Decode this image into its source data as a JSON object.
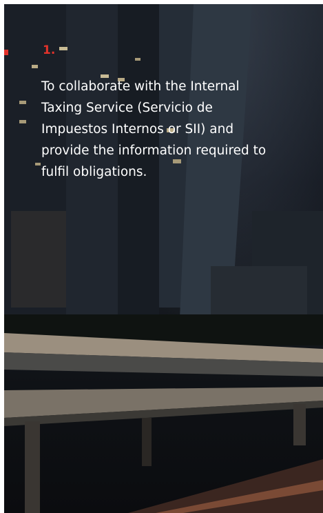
{
  "item": {
    "number": "1.",
    "text": "To collaborate with the Internal Taxing Service (Servicio de Impuestos Internos or SII) and provide the information required to fulfil obligations."
  },
  "colors": {
    "accent": "#e3332b",
    "text": "#ffffff",
    "background": "#151a21"
  },
  "background_image": "night city skyline with elevated highway"
}
